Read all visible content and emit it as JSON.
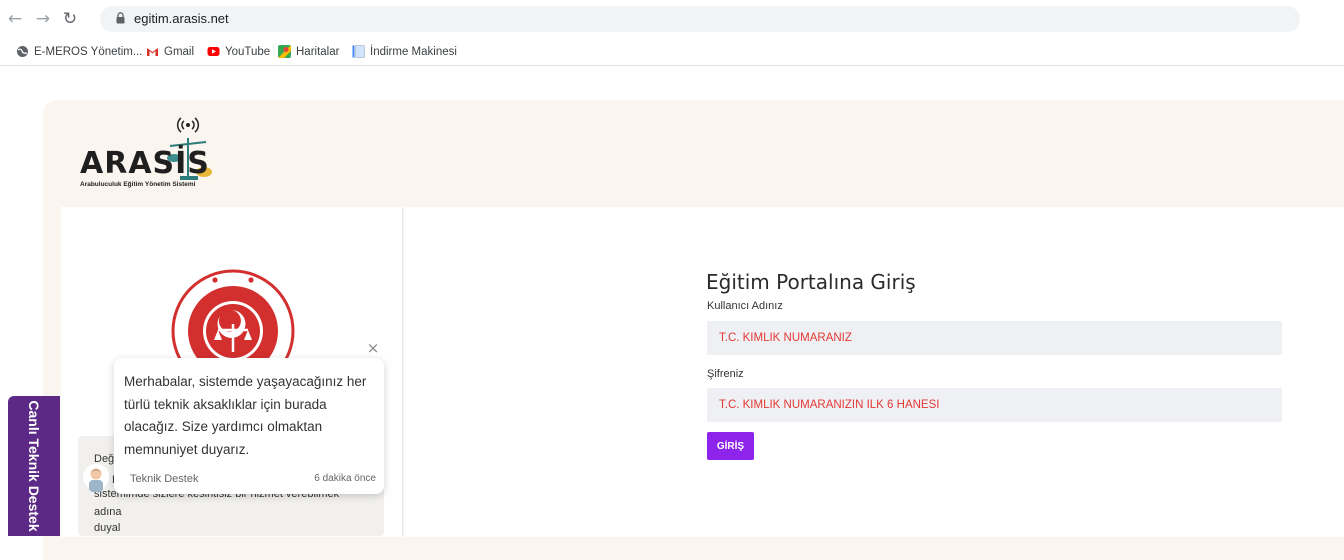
{
  "browser": {
    "url": "egitim.arasis.net",
    "bookmarks": [
      {
        "label": "E-MEROS Yönetim...",
        "icon": "globe-icon"
      },
      {
        "label": "Gmail",
        "icon": "gmail-icon"
      },
      {
        "label": "YouTube",
        "icon": "youtube-icon"
      },
      {
        "label": "Haritalar",
        "icon": "maps-icon"
      },
      {
        "label": "İndirme Makinesi",
        "icon": "page-icon"
      }
    ]
  },
  "brand": {
    "logo_text": "ARASİS",
    "logo_subtitle": "Arabuluculuk Eğitim Yönetim Sistemi"
  },
  "notice": {
    "lines": [
      "Değe",
      "E",
      "sistemimde sizlere kesintisiz bir hizmet verebilmek",
      "adına",
      "duyal"
    ]
  },
  "login": {
    "title": "Eğitim Portalına Giriş",
    "username_label": "Kullanıcı Adınız",
    "username_placeholder": "T.C. KİMLİK NUMARANIZ",
    "password_label": "Şifreniz",
    "password_placeholder": "T.C. KİMLİK NUMARANIZIN İLK 6 HANESİ",
    "submit_label": "GİRİŞ"
  },
  "support": {
    "tab_label": "Canlı Teknik Destek",
    "message": "Merhabalar, sistemde yaşayacağınız her türlü teknik aksaklıklar için burada olacağız. Size yardımcı olmaktan memnuniyet duyarız.",
    "sender": "Teknik Destek",
    "time": "6 dakika önce"
  },
  "colors": {
    "accent": "#8e24ec",
    "support_tab": "#5c2a86",
    "placeholder_red": "#e53935",
    "page_bg": "#faf5ef"
  }
}
